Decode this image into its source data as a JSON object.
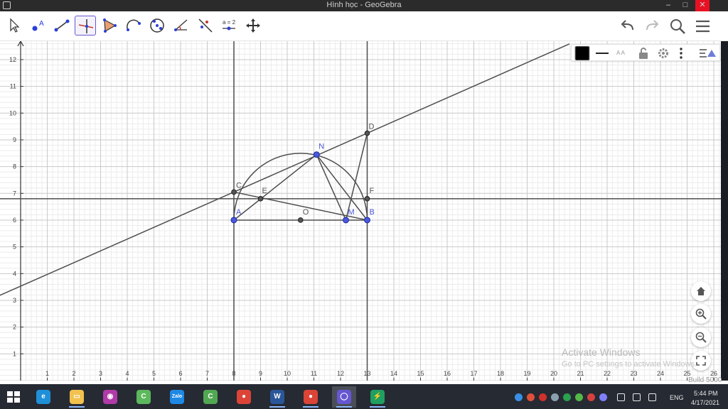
{
  "window": {
    "title": "Hình học - GeoGebra",
    "minimize_glyph": "–",
    "maximize_glyph": "□",
    "close_glyph": "✕"
  },
  "toolbar": {
    "tools": [
      {
        "id": "move",
        "icon": "move-cursor-icon"
      },
      {
        "id": "point",
        "icon": "point-icon",
        "label": "A"
      },
      {
        "id": "segment",
        "icon": "segment-icon"
      },
      {
        "id": "perpendicular",
        "icon": "perpendicular-line-icon",
        "selected": true
      },
      {
        "id": "polygon",
        "icon": "polygon-icon"
      },
      {
        "id": "arc",
        "icon": "circular-arc-icon"
      },
      {
        "id": "circle",
        "icon": "circle-icon"
      },
      {
        "id": "angle",
        "icon": "angle-icon"
      },
      {
        "id": "reflect",
        "icon": "reflect-line-icon"
      },
      {
        "id": "slider",
        "icon": "slider-icon",
        "label": "a = 2"
      },
      {
        "id": "move-view",
        "icon": "move-graphics-icon"
      }
    ],
    "right": [
      "undo-icon",
      "redo-icon",
      "search-icon",
      "menu-icon"
    ]
  },
  "stylebar": {
    "color": "#000000",
    "text_size_label": "A A",
    "icons": [
      "color-swatch-icon",
      "line-style-icon",
      "text-size-icon",
      "unlock-icon",
      "settings-icon",
      "more-icon",
      "toggle-stylebar-icon"
    ]
  },
  "graphics": {
    "x_ticks": [
      "1",
      "2",
      "3",
      "4",
      "5",
      "6",
      "7",
      "8",
      "9",
      "10",
      "11",
      "12",
      "13",
      "14",
      "15",
      "16",
      "17",
      "18",
      "19",
      "20",
      "21",
      "22",
      "23",
      "24",
      "25",
      "26"
    ],
    "y_ticks": [
      "1",
      "2",
      "3",
      "4",
      "5",
      "6",
      "7",
      "8",
      "9",
      "10",
      "11",
      "12"
    ],
    "points": [
      {
        "name": "A",
        "x": 8,
        "y": 6,
        "free": true
      },
      {
        "name": "B",
        "x": 13,
        "y": 6,
        "free": true
      },
      {
        "name": "O",
        "x": 10.5,
        "y": 6
      },
      {
        "name": "M",
        "x": 12.2,
        "y": 6,
        "free": true
      },
      {
        "name": "C",
        "x": 8,
        "y": 7.05
      },
      {
        "name": "E",
        "x": 9,
        "y": 6.8
      },
      {
        "name": "F",
        "x": 13,
        "y": 6.8
      },
      {
        "name": "D",
        "x": 13,
        "y": 9.25
      },
      {
        "name": "N",
        "x": 11.1,
        "y": 8.45,
        "free": true
      }
    ],
    "semicircle": {
      "center": "O",
      "radius": 2.5
    },
    "lines": {
      "horizontal_y": 6.8,
      "vertical_x": [
        8,
        13
      ],
      "tangent_through": [
        "C",
        "D"
      ]
    },
    "segments": [
      [
        "A",
        "B"
      ],
      [
        "A",
        "N"
      ],
      [
        "N",
        "B"
      ],
      [
        "N",
        "M"
      ],
      [
        "M",
        "D"
      ],
      [
        "C",
        "B"
      ]
    ]
  },
  "zoom": [
    "home-icon",
    "zoom-in-icon",
    "zoom-out-icon",
    "fullscreen-icon"
  ],
  "watermark": {
    "line1": "Activate Windows",
    "line2": "Go to PC settings to activate Windows.",
    "build": "Build 5000"
  },
  "taskbar": {
    "apps": [
      {
        "name": "edge",
        "color": "#1f8fd8",
        "glyph": "e"
      },
      {
        "name": "explorer",
        "color": "#f2c14e",
        "glyph": "▭"
      },
      {
        "name": "camera",
        "color": "#b03aa8",
        "glyph": "◉"
      },
      {
        "name": "coccoc",
        "color": "#5cb85c",
        "glyph": "C"
      },
      {
        "name": "zalo",
        "color": "#1e88e5",
        "glyph": "Zalo"
      },
      {
        "name": "coccoc2",
        "color": "#52a852",
        "glyph": "C"
      },
      {
        "name": "chrome",
        "color": "#db4437",
        "glyph": "●"
      },
      {
        "name": "word",
        "color": "#2b579a",
        "glyph": "W"
      },
      {
        "name": "chrome2",
        "color": "#db4437",
        "glyph": "●"
      },
      {
        "name": "geogebra",
        "color": "#6557d2",
        "glyph": "◯"
      },
      {
        "name": "security",
        "color": "#20a060",
        "glyph": "⚡"
      }
    ],
    "tray_colors": [
      "#3a8ee6",
      "#e0503a",
      "#d0312d",
      "#8aa0b0",
      "#2aa050",
      "#54b848",
      "#d64040",
      "#8080ff"
    ],
    "lang": "ENG",
    "time": "5:44 PM",
    "date": "4/17/2021"
  }
}
